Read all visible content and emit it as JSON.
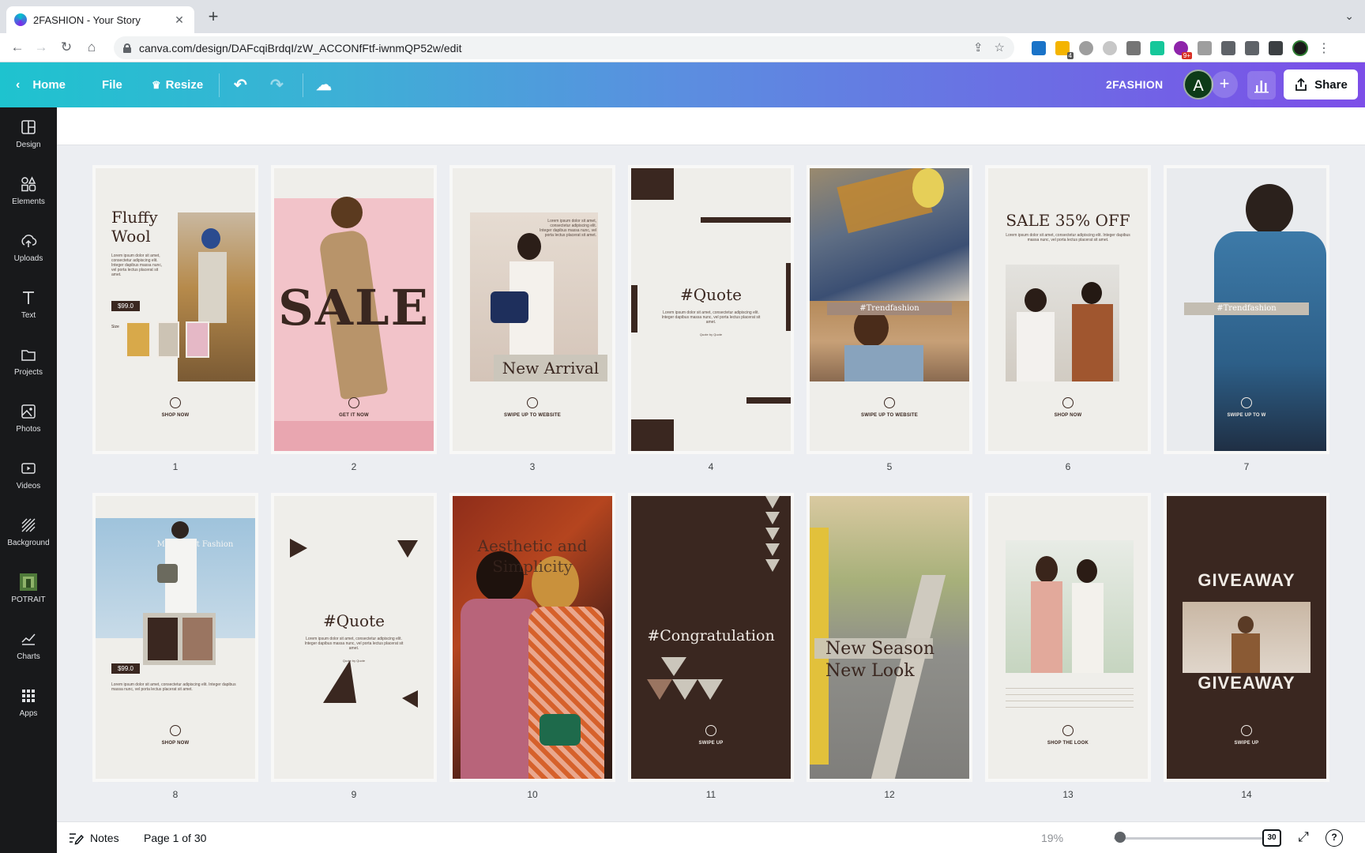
{
  "browser": {
    "tab_title": "2FASHION - Your Story",
    "tab_close": "✕",
    "new_tab": "+",
    "url": "canva.com/design/DAFcqiBrdqI/zW_ACCONfFtf-iwnmQP52w/edit",
    "ext_badges": [
      "4",
      "9+"
    ]
  },
  "toolbar": {
    "home_label": "Home",
    "file_label": "File",
    "resize_label": "Resize",
    "design_name": "2FASHION",
    "avatar_initial": "A",
    "share_label": "Share"
  },
  "sidebar": {
    "items": [
      {
        "label": "Design",
        "icon": "design-icon"
      },
      {
        "label": "Elements",
        "icon": "elements-icon"
      },
      {
        "label": "Uploads",
        "icon": "uploads-icon"
      },
      {
        "label": "Text",
        "icon": "text-icon"
      },
      {
        "label": "Projects",
        "icon": "projects-icon"
      },
      {
        "label": "Photos",
        "icon": "photos-icon"
      },
      {
        "label": "Videos",
        "icon": "videos-icon"
      },
      {
        "label": "Background",
        "icon": "background-icon"
      },
      {
        "label": "POTRAIT",
        "icon": "potrait-thumbnail"
      },
      {
        "label": "Charts",
        "icon": "charts-icon"
      },
      {
        "label": "Apps",
        "icon": "apps-icon"
      }
    ]
  },
  "pages": {
    "p1": {
      "num": "1",
      "title1": "Fluffy",
      "title2": "Wool",
      "price": "$99.0",
      "size": "Size",
      "cta": "SHOP NOW"
    },
    "p2": {
      "num": "2",
      "title": "SALE",
      "cta": "GET IT NOW"
    },
    "p3": {
      "num": "3",
      "title": "New Arrival",
      "cta": "SWIPE UP TO WEBSITE"
    },
    "p4": {
      "num": "4",
      "title": "#Quote",
      "quote_by": "Quote by Quote"
    },
    "p5": {
      "num": "5",
      "tag": "#Trendfashion",
      "cta": "SWIPE UP TO WEBSITE"
    },
    "p6": {
      "num": "6",
      "title": "SALE 35% OFF",
      "cta": "SHOP NOW"
    },
    "p7": {
      "num": "7",
      "tag": "#Trendfashion",
      "cta": "SWIPE UP TO W"
    },
    "p8": {
      "num": "8",
      "title": "Minimalist Fashion",
      "price": "$99.0",
      "cta": "SHOP NOW"
    },
    "p9": {
      "num": "9",
      "title": "#Quote",
      "quote_by": "Quote by Quote"
    },
    "p10": {
      "num": "10",
      "title1": "Aesthetic and",
      "title2": "Simplicity"
    },
    "p11": {
      "num": "11",
      "title": "#Congratulation",
      "cta": "SWIPE UP"
    },
    "p12": {
      "num": "12",
      "title1": "New Season",
      "title2": "New Look"
    },
    "p13": {
      "num": "13",
      "cta": "SHOP THE LOOK"
    },
    "p14": {
      "num": "14",
      "title1": "GIVEAWAY",
      "title2": "GIVEAWAY",
      "cta": "SWIPE UP"
    }
  },
  "lorem": {
    "short": "Lorem ipsum dolor sit amet, consectetur adipiscing elit. Integer dapibus massa nunc, vel porta lectus placerat sit amet."
  },
  "bottombar": {
    "notes_label": "Notes",
    "page_indicator": "Page 1 of 30",
    "zoom": "19%",
    "page_count_badge": "30",
    "zoom_slider_fraction": 0.19
  },
  "colors": {
    "toolbar_start": "#1ec3cf",
    "toolbar_end": "#7c4ee8",
    "template_brown": "#3a2720",
    "template_cream": "#efeeea",
    "sidebar_bg": "#18191b"
  }
}
